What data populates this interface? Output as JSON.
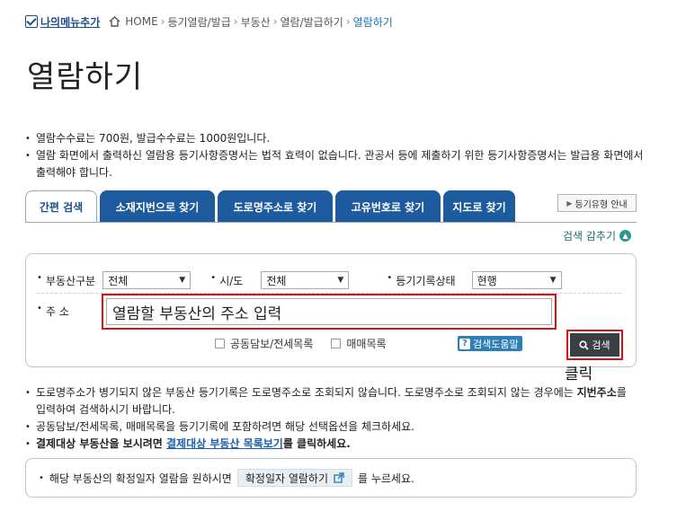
{
  "topbar": {
    "mymenu_label": "나의메뉴추가",
    "breadcrumb": [
      "HOME",
      "등기열람/발급",
      "부동산",
      "열람/발급하기",
      "열람하기"
    ]
  },
  "page_title": "열람하기",
  "notices": [
    "열람수수료는 700원, 발급수수료는 1000원입니다.",
    "열람 화면에서 출력하신 열람용 등기사항증명서는 법적 효력이 없습니다. 관공서 등에 제출하기 위한 등기사항증명서는 발급용 화면에서 출력해야 합니다."
  ],
  "tabs": [
    "간편 검색",
    "소재지번으로 찾기",
    "도로명주소로 찾기",
    "고유번호로 찾기",
    "지도로 찾기"
  ],
  "guide_button": "등기유형 안내",
  "collapse_label": "검색 감추기",
  "search": {
    "type_label": "부동산구분",
    "type_value": "전체",
    "city_label": "시/도",
    "city_value": "전체",
    "status_label": "등기기록상태",
    "status_value": "현행",
    "address_label": "주 소",
    "address_placeholder": "열람할 부동산의 주소 입력",
    "option1": "공동담보/전세목록",
    "option2": "매매목록",
    "help_label": "검색도움말",
    "search_label": "검색"
  },
  "click_label": "클릭",
  "notes": {
    "n1_a": "도로명주소가 병기되지 않은 부동산 등기기록은 도로명주소로 조회되지 않습니다. 도로명주소로 조회되지 않는 경우에는 ",
    "n1_b": "지번주소",
    "n1_c": "를 입력하여 검색하시기 바랍니다.",
    "n2": "공동담보/전세목록, 매매목록을 등기기록에 포함하려면 해당 선택옵션을 체크하세요.",
    "n3_a": "결제대상 부동산을 보시려면 ",
    "n3_link": "결제대상 부동산 목록보기",
    "n3_c": "를 클릭하세요."
  },
  "bottom": {
    "text_before": "해당 부동산의 확정일자 열람을 원하시면",
    "button_label": "확정일자 열람하기",
    "text_after": "를 누르세요."
  },
  "colors": {
    "tab_blue": "#1d5a9e",
    "highlight_red": "#e01010",
    "search_button": "#3b3f44"
  }
}
